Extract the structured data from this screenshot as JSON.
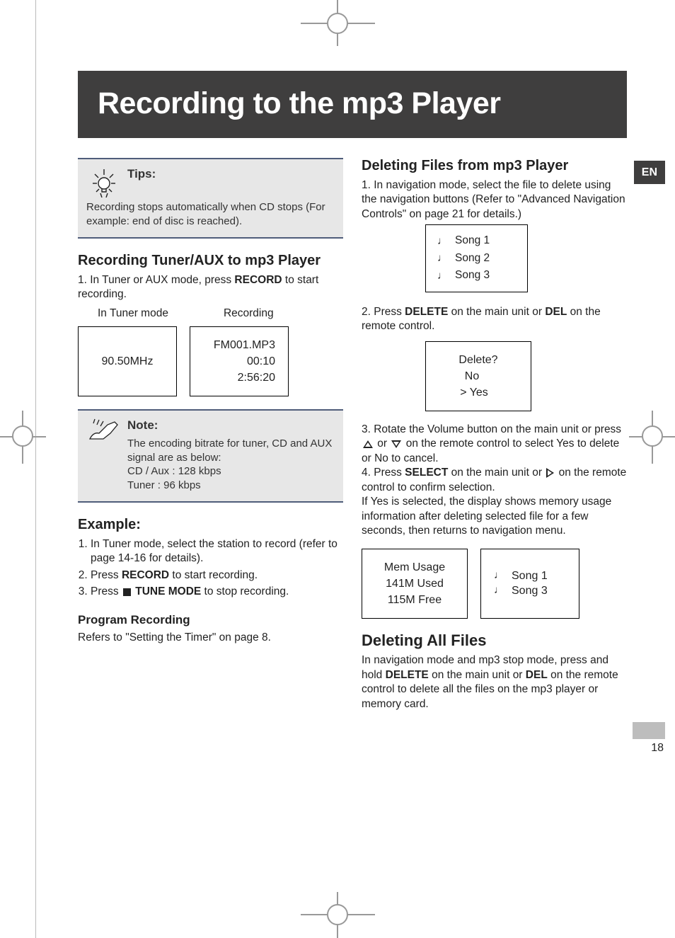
{
  "lang_tab": "EN",
  "page_number": "18",
  "title": "Recording to the mp3 Player",
  "left": {
    "tips": {
      "label": "Tips:",
      "body": "Recording stops automatically when CD stops (For example: end of disc is reached)."
    },
    "sec1": {
      "heading": "Recording Tuner/AUX to mp3 Player",
      "step1_pre": "1. In Tuner or AUX mode, press ",
      "step1_kw": "RECORD",
      "step1_post": " to start recording.",
      "mode_label_left": "In Tuner mode",
      "mode_label_right": "Recording",
      "lcd_left": {
        "l1": "90.50MHz"
      },
      "lcd_right": {
        "l1": "FM001.MP3",
        "l2": "00:10",
        "l3": "2:56:20"
      }
    },
    "note": {
      "label": "Note:",
      "line1": "The encoding bitrate for tuner, CD and AUX signal are as below:",
      "line2": "CD / Aux : 128 kbps",
      "line3": "Tuner : 96 kbps"
    },
    "example": {
      "heading": "Example:",
      "s1": "In Tuner mode, select the station to record (refer to page 14-16 for details).",
      "s2_pre": "Press ",
      "s2_kw": "RECORD",
      "s2_post": " to start recording.",
      "s3_pre": "Press ",
      "s3_kw": "TUNE MODE",
      "s3_post": " to stop recording."
    },
    "program": {
      "heading": "Program Recording",
      "body": "Refers to \"Setting the Timer\" on page 8."
    }
  },
  "right": {
    "del_files": {
      "heading": "Deleting Files from mp3 Player",
      "s1": "In navigation mode, select the file to delete using the navigation buttons (Refer to \"Advanced Navigation Controls\" on page 21 for details.)",
      "songs_a": [
        "Song 1",
        "Song 2",
        "Song 3"
      ],
      "s2_pre": "Press ",
      "s2_kw1": "DELETE",
      "s2_mid": " on the main unit or ",
      "s2_kw2": "DEL",
      "s2_post": " on the remote control.",
      "lcd_delete": {
        "l1": "Delete?",
        "l2": "No",
        "l3": "> Yes"
      },
      "s3a": "Rotate the Volume button on the main unit or press ",
      "s3b": " or ",
      "s3c": " on the remote control to select Yes to delete or No to cancel.",
      "s4_pre": "Press ",
      "s4_kw": "SELECT",
      "s4_mid": " on the main unit or ",
      "s4_post": " on the remote control to confirm selection.",
      "s4_tail": "If Yes is selected, the display shows memory usage information after deleting selected file for a few seconds, then returns to navigation menu.",
      "lcd_mem": {
        "l1": "Mem Usage",
        "l2": "141M Used",
        "l3": "115M Free"
      },
      "songs_b": [
        "Song 1",
        "Song 3"
      ]
    },
    "del_all": {
      "heading": "Deleting All Files",
      "body_pre": "In navigation mode and mp3 stop mode, press and hold ",
      "kw1": "DELETE",
      "body_mid": " on the main unit or ",
      "kw2": "DEL",
      "body_post": " on the remote control to delete all the files on the mp3 player or memory card."
    }
  }
}
